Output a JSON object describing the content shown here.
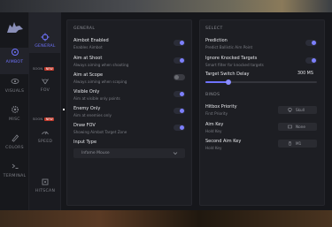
{
  "rail": {
    "items": [
      {
        "label": "AIMBOT",
        "icon": "target-icon",
        "active": true
      },
      {
        "label": "VISUALS",
        "icon": "eye-icon"
      },
      {
        "label": "MISC",
        "icon": "gear-icon"
      },
      {
        "label": "COLORS",
        "icon": "palette-icon"
      },
      {
        "label": "TERMINAL",
        "icon": "terminal-icon"
      }
    ]
  },
  "subnav": {
    "items": [
      {
        "label": "GENERAL",
        "icon": "crosshair-icon",
        "active": true
      },
      {
        "label": "FOV",
        "icon": "fov-icon"
      },
      {
        "label": "SPEED",
        "icon": "speed-icon"
      },
      {
        "label": "HITSCAN",
        "icon": "hitscan-icon"
      }
    ],
    "tags": [
      {
        "text": "SOON",
        "badge": "NEW"
      },
      {
        "text": "SOON",
        "badge": "NEW"
      }
    ]
  },
  "general": {
    "title": "GENERAL",
    "options": [
      {
        "title": "Aimbot Enabled",
        "desc": "Enables Aimbot",
        "on": true
      },
      {
        "title": "Aim at Shoot",
        "desc": "Always aiming when shooting",
        "on": true
      },
      {
        "title": "Aim at Scope",
        "desc": "Always aiming when scoping",
        "on": false
      },
      {
        "title": "Visible Only",
        "desc": "Aim at visible only points",
        "on": true
      },
      {
        "title": "Enemy Only",
        "desc": "Aim at enemies only",
        "on": true
      },
      {
        "title": "Draw FOV",
        "desc": "Showing Aimbot Target Zone",
        "on": true
      }
    ],
    "input_type_label": "Input Type",
    "input_type_value": "Infame Mouse"
  },
  "select": {
    "title": "SELECT",
    "options": [
      {
        "title": "Prediction",
        "desc": "Predict Ballistic Aim Point",
        "on": true
      },
      {
        "title": "Ignore Knocked Targets",
        "desc": "Smart filter for knocked targets",
        "on": true
      }
    ],
    "slider": {
      "title": "Target Switch Delay",
      "value": "300 MS",
      "fraction": 0.21
    }
  },
  "binds": {
    "title": "BINDS",
    "items": [
      {
        "title": "Hitbox Priority",
        "desc": "First Priority",
        "key": "Skull",
        "icon": "skull-icon"
      },
      {
        "title": "Aim Key",
        "desc": "Hold Key",
        "key": "None",
        "icon": "keyboard-icon"
      },
      {
        "title": "Second Aim Key",
        "desc": "Hold Key",
        "key": "M1",
        "icon": "mouse-icon"
      }
    ]
  },
  "colors": {
    "accent": "#6f73ff",
    "panel": "#1d1e23",
    "background": "#16171b"
  }
}
